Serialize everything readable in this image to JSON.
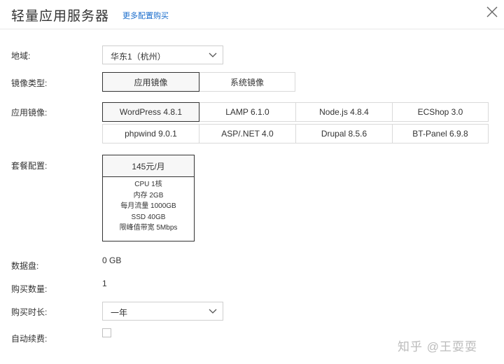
{
  "header": {
    "title": "轻量应用服务器",
    "more_link": "更多配置购买"
  },
  "region": {
    "label": "地域:",
    "value": "华东1（杭州）"
  },
  "image_type": {
    "label": "镜像类型:",
    "options": [
      "应用镜像",
      "系统镜像"
    ],
    "selected": "应用镜像"
  },
  "app_image": {
    "label": "应用镜像:",
    "options": [
      "WordPress 4.8.1",
      "LAMP 6.1.0",
      "Node.js 4.8.4",
      "ECShop 3.0",
      "phpwind 9.0.1",
      "ASP/.NET 4.0",
      "Drupal 8.5.6",
      "BT-Panel 6.9.8"
    ],
    "selected": "WordPress 4.8.1"
  },
  "package": {
    "label": "套餐配置:",
    "price": "145元/月",
    "specs": [
      "CPU 1核",
      "内存 2GB",
      "每月流量 1000GB",
      "SSD 40GB",
      "限峰值带宽 5Mbps"
    ]
  },
  "data_disk": {
    "label": "数据盘:",
    "value": "0 GB"
  },
  "quantity": {
    "label": "购买数量:",
    "value": "1"
  },
  "duration": {
    "label": "购买时长:",
    "value": "一年"
  },
  "auto_renew": {
    "label": "自动续费:",
    "checked": false
  },
  "watermark": "知乎 @王耍耍"
}
